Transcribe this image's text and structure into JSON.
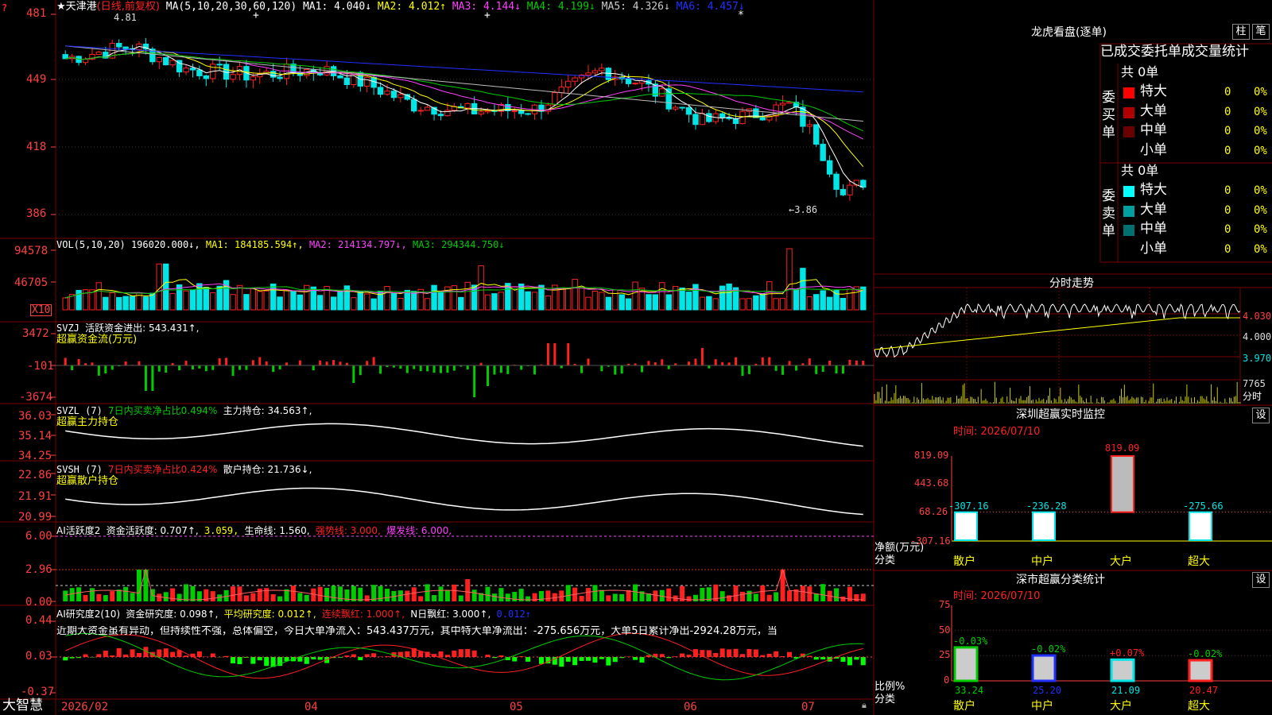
{
  "colors": {
    "up": "#ff2020",
    "down": "#00e5e5",
    "green": "#00cc00",
    "yellow": "#ffff00",
    "magenta": "#ff40ff",
    "white": "#ffffff",
    "grid": "#7a0000",
    "blue": "#2030ff"
  },
  "main_chart": {
    "stock_name": "天津港",
    "mode_text": "(日线,前复权)",
    "ma_params": "MA(5,10,20,30,60,120)",
    "ma1": "MA1: 4.040↓",
    "ma2": "MA2: 4.012↑",
    "ma3": "MA3: 4.144↓",
    "ma4": "MA4: 4.199↓",
    "ma5": "MA5: 4.326↓",
    "ma6": "MA6: 4.457↓",
    "y_ticks": [
      "481",
      "449",
      "418",
      "386"
    ],
    "high_label": "4.81",
    "low_label": "←3.86",
    "markers": [
      "+",
      "+",
      "*"
    ]
  },
  "volume": {
    "header": "VOL(5,10,20)",
    "value": "196020.000↓,",
    "ma1": "MA1: 184185.594↑,",
    "ma2": "MA2: 214134.797↓,",
    "ma3": "MA3: 294344.750↓",
    "y_ticks": [
      "94578",
      "46705"
    ],
    "unit": "X10"
  },
  "svzj": {
    "header": "SVZJ",
    "label": "活跃资金进出: 543.431↑,",
    "sub": "超赢资金流(万元)",
    "y_ticks": [
      "3472",
      "-101",
      "-3674"
    ]
  },
  "svzl": {
    "header": "SVZL (7)",
    "ratio": "7日内买卖净占比0.494%",
    "hold": "主力持仓: 34.563↑,",
    "sub": "超赢主力持仓",
    "y_ticks": [
      "36.03",
      "35.14",
      "34.25"
    ]
  },
  "svsh": {
    "header": "SVSH (7)",
    "ratio": "7日内买卖净占比0.424%",
    "hold": "散户持仓: 21.736↓,",
    "sub": "超赢散户持仓",
    "y_ticks": [
      "22.86",
      "21.91",
      "20.99"
    ]
  },
  "ai_active": {
    "header": "AI活跃度2",
    "label": "资金活跃度: 0.707↑,",
    "v2": "3.059,",
    "life": "生命线: 1.560,",
    "strong": "强势线: 3.000,",
    "burst": "爆发线: 6.000,",
    "y_ticks": [
      "6.00",
      "2.96",
      "0.00"
    ]
  },
  "ai_research": {
    "header": "AI研究度2(10)",
    "label": "资金研究度: 0.098↑,",
    "avg": "平均研究度: 0.012↑,",
    "cont": "连续飘红: 1.000↑,",
    "nday": "N日飘红: 3.000↑,",
    "last": "0.012↑",
    "commentary": "近期大资金虽有异动，但持续性不强，总体偏空，今日大单净流入：543.437万元，其中特大单净流出：-275.656万元，大单5日累计净出-2924.28万元，当",
    "y_ticks": [
      "0.44",
      "0.03",
      "-0.37"
    ]
  },
  "x_axis": {
    "brand": "大智慧",
    "labels": [
      "2026/02",
      "04",
      "05",
      "06",
      "07"
    ]
  },
  "dragon_tiger": {
    "title": "龙虎看盘(逐单)",
    "btn1": "柱",
    "btn2": "笔",
    "stats_title": "已成交委托单成交量统计",
    "buy_side": "委买单",
    "sell_side": "委卖单",
    "buy_total": "共 0单",
    "sell_total": "共 0单",
    "buy_rows": [
      {
        "label": "特大",
        "count": "0",
        "pct": "0%",
        "color": "#ff0000"
      },
      {
        "label": "大单",
        "count": "0",
        "pct": "0%",
        "color": "#b00000"
      },
      {
        "label": "中单",
        "count": "0",
        "pct": "0%",
        "color": "#6a0000"
      },
      {
        "label": "小单",
        "count": "0",
        "pct": "0%",
        "color": "#000000"
      }
    ],
    "sell_rows": [
      {
        "label": "特大",
        "count": "0",
        "pct": "0%",
        "color": "#00ffff"
      },
      {
        "label": "大单",
        "count": "0",
        "pct": "0%",
        "color": "#00a0a0"
      },
      {
        "label": "中单",
        "count": "0",
        "pct": "0%",
        "color": "#007070"
      },
      {
        "label": "小单",
        "count": "0",
        "pct": "0%",
        "color": "#000000"
      }
    ]
  },
  "intraday": {
    "title": "分时走势",
    "y_ticks": [
      "4.030",
      "4.000",
      "3.970"
    ],
    "vol_tick": "7765",
    "vol_label": "分时"
  },
  "monitor": {
    "title": "深圳超赢实时监控",
    "set_btn": "设",
    "time": "时间: 2026/07/10",
    "y_ticks": [
      "819.09",
      "443.68",
      "68.26",
      "-307.16"
    ],
    "net_label": "净额(万元)",
    "cat_label": "分类",
    "bars": [
      {
        "cat": "散户",
        "value": -307.16,
        "label": "-307.16"
      },
      {
        "cat": "中户",
        "value": -236.28,
        "label": "-236.28"
      },
      {
        "cat": "大户",
        "value": 819.09,
        "label": "819.09"
      },
      {
        "cat": "超大",
        "value": -275.66,
        "label": "-275.66"
      }
    ]
  },
  "classify": {
    "title": "深市超赢分类统计",
    "set_btn": "设",
    "time": "时间: 2026/07/10",
    "y_ticks": [
      "75",
      "50",
      "25",
      "0"
    ],
    "ratio_label": "比例%",
    "cat_label": "分类",
    "bars": [
      {
        "cat": "散户",
        "value": 33.24,
        "delta": "-0.03%",
        "color": "#00cc00"
      },
      {
        "cat": "中户",
        "value": 25.2,
        "delta": "-0.02%",
        "color": "#2030ff"
      },
      {
        "cat": "大户",
        "value": 21.09,
        "delta": "+0.07%",
        "color": "#00e5e5"
      },
      {
        "cat": "超大",
        "value": 20.47,
        "delta": "-0.02%",
        "color": "#ff2020"
      }
    ]
  }
}
